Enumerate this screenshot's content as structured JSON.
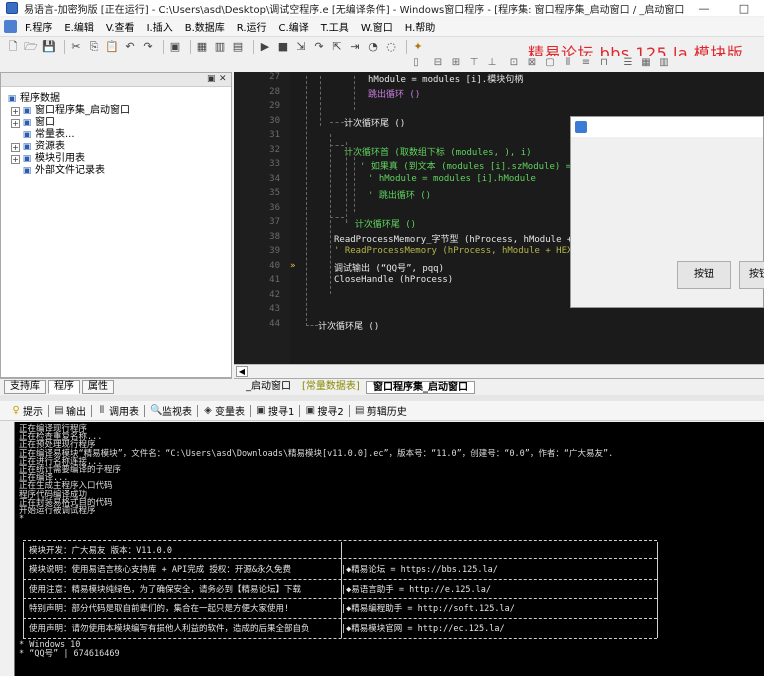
{
  "window": {
    "title": "易语言-加密狗版 [正在运行] - C:\\Users\\asd\\Desktop\\调试空程序.e [无编译条件] - Windows窗口程序 - [程序集: 窗口程序集_启动窗口 / _启动窗口]",
    "minimize": "—",
    "maximize": "□"
  },
  "menu": [
    "F.程序",
    "E.编辑",
    "V.查看",
    "I.插入",
    "B.数据库",
    "R.运行",
    "C.编译",
    "T.工具",
    "W.窗口",
    "H.帮助"
  ],
  "watermark": "精易论坛 bbs.125.la 模块版",
  "left_panel": {
    "tree": [
      {
        "label": "程序数据",
        "icon": "database-icon",
        "expander": "",
        "indent": 0
      },
      {
        "label": "窗口程序集_启动窗口",
        "icon": "program-set-icon",
        "expander": "+",
        "indent": 1
      },
      {
        "label": "窗口",
        "icon": "window-icon",
        "expander": "+",
        "indent": 1
      },
      {
        "label": "常量表...",
        "icon": "constant-table-icon",
        "expander": "",
        "indent": 1
      },
      {
        "label": "资源表",
        "icon": "resource-icon",
        "expander": "+",
        "indent": 1
      },
      {
        "label": "模块引用表",
        "icon": "module-icon",
        "expander": "+",
        "indent": 1
      },
      {
        "label": "外部文件记录表",
        "icon": "file-record-icon",
        "expander": "",
        "indent": 1
      }
    ],
    "tabs": [
      "支持库",
      "程序",
      "属性"
    ]
  },
  "editor": {
    "line_numbers": [
      "27",
      "28",
      "29",
      "30",
      "31",
      "32",
      "33",
      "34",
      "35",
      "36",
      "37",
      "38",
      "39",
      "40",
      "41",
      "42",
      "43",
      "44"
    ],
    "lines": [
      {
        "text": "hModule = modules [i].模块句柄",
        "color": "white",
        "indent": 134
      },
      {
        "text": "跳出循环 ()",
        "color": "purple",
        "indent": 134
      },
      {
        "text": "",
        "color": "white",
        "indent": 134
      },
      {
        "text": "计次循环尾 ()",
        "color": "white",
        "indent": 110
      },
      {
        "text": "",
        "color": "white",
        "indent": 110
      },
      {
        "text": "计次循环首 (取数组下标 (modules, ), i)",
        "color": "green",
        "indent": 110
      },
      {
        "text": "' 如果真 (到文本 (modules [i].szModule) = ",
        "color": "green",
        "indent": 126
      },
      {
        "text": "' hModule = modules [i].hModule",
        "color": "green",
        "indent": 134
      },
      {
        "text": "' 跳出循环 ()",
        "color": "green",
        "indent": 134
      },
      {
        "text": "",
        "color": "white",
        "indent": 110
      },
      {
        "text": "' 计次循环尾 ()",
        "color": "green",
        "indent": 110
      },
      {
        "text": "ReadProcessMemory_字节型 (hProcess, hModule + 进制",
        "color": "white",
        "indent": 100
      },
      {
        "text": "' ReadProcessMemory (hProcess, hModule + HEX_to_D",
        "color": "olive",
        "indent": 100
      },
      {
        "text": "调试输出 (“QQ号”, pqq)",
        "color": "white",
        "indent": 100
      },
      {
        "text": "CloseHandle (hProcess)",
        "color": "white",
        "indent": 100
      },
      {
        "text": "",
        "color": "white",
        "indent": 100
      },
      {
        "text": "",
        "color": "white",
        "indent": 100
      },
      {
        "text": "计次循环尾 ()",
        "color": "white",
        "indent": 84
      }
    ],
    "tabs": [
      "_启动窗口",
      "[常量数据表]",
      "窗口程序集_启动窗口"
    ]
  },
  "dialog": {
    "button1": "按钮",
    "button2": "按钮"
  },
  "output_tabs": [
    "提示",
    "输出",
    "调用表",
    "监视表",
    "变量表",
    "搜寻1",
    "搜寻2",
    "剪辑历史"
  ],
  "output": {
    "log": [
      "正在编译现行程序",
      "正在检查重复名称...",
      "正在预处理现行程序",
      "正在编译易模块“精易模块”，文件名：“C:\\Users\\asd\\Downloads\\精易模块[v11.0.0].ec”，版本号：“11.0”，创建号：“0.0”，作者：“广大易友”.",
      "正在进行名称连接...",
      "正在统计需要编译的子程序",
      "正在编译...",
      "正在生成主程序入口代码",
      "程序代码编译成功",
      "正在封装易格式目的代码",
      "开始运行被调试程序",
      "*"
    ],
    "box_rows": [
      {
        "left": "模块开发：广大易友     版本：V11.0.0",
        "right": ""
      },
      {
        "left": "模块说明：使用易语言核心支持库 + API完成      授权：开源&永久免费",
        "right": "|◆精易论坛        = https://bbs.125.la/"
      },
      {
        "left": "使用注意：精易模块纯绿色，为了确保安全，请务必到【精易论坛】下载",
        "right": "|◆易语言助手      = http://e.125.la/"
      },
      {
        "left": "特别声明：部分代码是取自前辈们的，集合在一起只是方便大家使用!",
        "right": "|◆精易编程助手    = http://soft.125.la/"
      },
      {
        "left": "使用声明：请勿使用本模块编写有损他人利益的软件，造成的后果全部自负",
        "right": "|◆精易模块官网    = http://ec.125.la/"
      }
    ],
    "tail": [
      "* Windows 10",
      "* “QQ号” | 674616469"
    ]
  }
}
